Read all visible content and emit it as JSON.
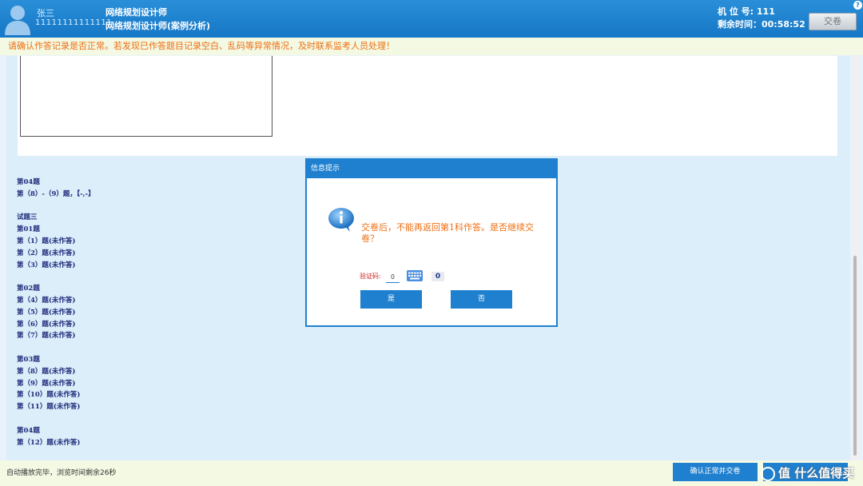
{
  "header": {
    "user_name": "张三",
    "user_id": "11111111111111",
    "exam_title": "网络规划设计师",
    "exam_subtitle": "网络规划设计师(案例分析)",
    "seat_label": "机 位 号: 111",
    "time_label": "剩余时间：00:58:52",
    "submit_label": "交卷",
    "help_label": "?"
  },
  "warning": "请确认作答记录是否正常。若发现已作答题目记录空白、乱码等异常情况，及时联系监考人员处理！",
  "question_list": [
    "第04题",
    "第（8）-（9）题，【-,-】",
    "",
    "试题三",
    "第01题",
    "第（1）题(未作答)",
    "第（2）题(未作答)",
    "第（3）题(未作答)",
    "",
    "第02题",
    "第（4）题(未作答)",
    "第（5）题(未作答)",
    "第（6）题(未作答)",
    "第（7）题(未作答)",
    "",
    "第03题",
    "第（8）题(未作答)",
    "第（9）题(未作答)",
    "第（10）题(未作答)",
    "第（11）题(未作答)",
    "",
    "第04题",
    "第（12）题(未作答)"
  ],
  "dialog": {
    "title": "信息提示",
    "message": "交卷后，不能再返回第1科作答。是否继续交卷？",
    "captcha_label": "验证码:",
    "captcha_value": "0",
    "captcha_image_text": "0",
    "yes_label": "是",
    "no_label": "否"
  },
  "footer": {
    "status": "自动播放完毕，浏览时间剩余26秒",
    "confirm_label": "确认正常并交卷",
    "watermark": "值 什么值得买"
  },
  "colors": {
    "header_bg": "#1f80cf",
    "warning_text": "#ef6e12",
    "button_bg": "#1f80cf",
    "question_text": "#1e2a7a"
  }
}
